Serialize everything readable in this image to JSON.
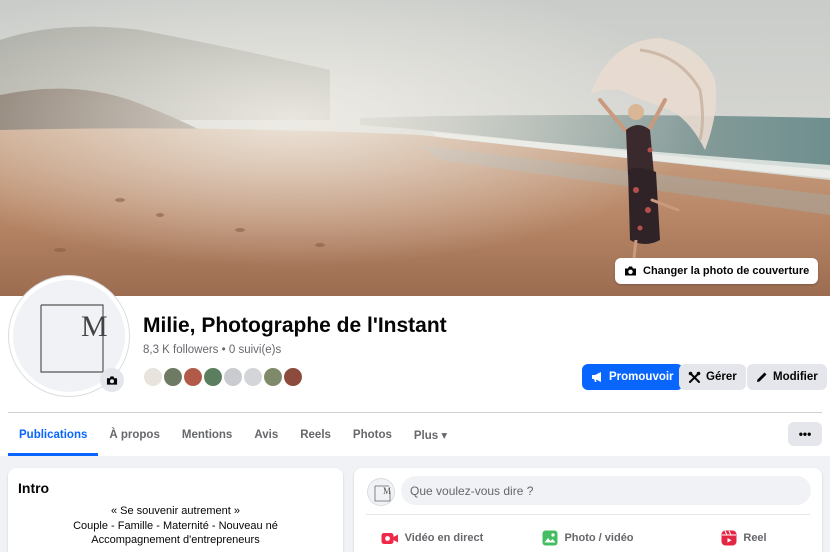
{
  "cover": {
    "change_cover_label": "Changer la photo de couverture",
    "camera_icon": "camera-icon"
  },
  "profile": {
    "name": "Milie, Photographe de l'Instant",
    "followers": "8,3 K followers",
    "separator": " • ",
    "following": "0 suivi(e)s",
    "avatar_logo_letter": "M"
  },
  "actions": {
    "promote_label": "Promouvoir",
    "manage_label": "Gérer",
    "edit_label": "Modifier",
    "more_label": "•••"
  },
  "tabs": [
    {
      "label": "Publications",
      "active": true
    },
    {
      "label": "À propos"
    },
    {
      "label": "Mentions"
    },
    {
      "label": "Avis"
    },
    {
      "label": "Reels"
    },
    {
      "label": "Photos"
    },
    {
      "label": "Plus ▾"
    }
  ],
  "intro": {
    "title": "Intro",
    "lines": [
      "« Se souvenir autrement »",
      "Couple - Famille - Maternité - Nouveau né",
      "Accompagnement d'entrepreneurs"
    ]
  },
  "composer": {
    "placeholder": "Que voulez-vous dire ?",
    "live_label": "Vidéo en direct",
    "photo_label": "Photo / vidéo",
    "reel_label": "Reel"
  },
  "colors": {
    "accent": "#0866ff",
    "live": "#f02849",
    "photo": "#45bd62",
    "reel": "#e42645"
  }
}
